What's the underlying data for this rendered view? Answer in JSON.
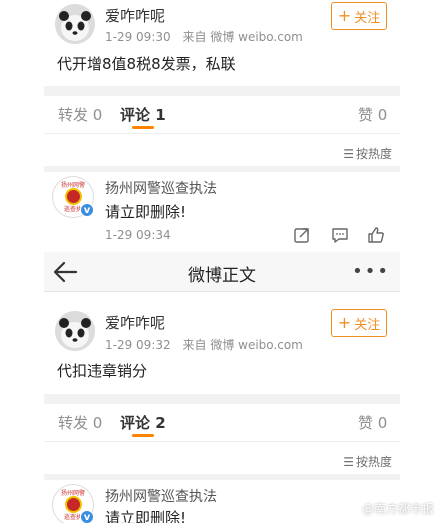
{
  "post1": {
    "username": "爱咋咋呢",
    "time": "1-29 09:30",
    "source_prefix": "来自",
    "source": "微博 weibo.com",
    "follow_label": "关注",
    "text": "代开增8值8税8发票，私联",
    "tabs": {
      "repost": "转发 0",
      "comment": "评论 1",
      "like": "赞 0"
    },
    "sort_label": "按热度",
    "comment": {
      "author": "扬州网警巡查执法",
      "text": "请立即删除!",
      "time": "1-29 09:34",
      "avatar_top": "扬州网警",
      "avatar_bottom": "巡查执"
    }
  },
  "navbar": {
    "title": "微博正文",
    "back_icon": "back-arrow-icon",
    "more_icon": "more-dots-icon"
  },
  "post2": {
    "username": "爱咋咋呢",
    "time": "1-29 09:32",
    "source_prefix": "来自",
    "source": "微博 weibo.com",
    "follow_label": "关注",
    "text": "代扣违章销分",
    "tabs": {
      "repost": "转发 0",
      "comment": "评论 2",
      "like": "赞 0"
    },
    "sort_label": "按热度",
    "comment": {
      "author": "扬州网警巡查执法",
      "text": "请立即删除!",
      "avatar_top": "扬州网警",
      "avatar_bottom": "巡查执"
    }
  },
  "watermark": "@南方都市报",
  "colors": {
    "accent": "#ff8200",
    "follow": "#f08f24",
    "verified": "#3b8de0"
  }
}
